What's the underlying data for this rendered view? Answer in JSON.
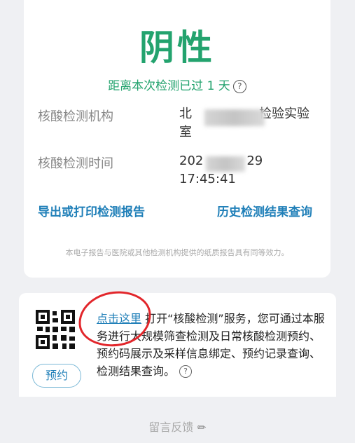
{
  "result": {
    "status": "阴性",
    "since_text": "距离本次检测已过 1 天",
    "help_icon": "?"
  },
  "details": {
    "institution_label": "核酸检测机构",
    "institution_value_start": "北",
    "institution_value_end": "检验实验",
    "institution_value_line2": "室",
    "time_label": "核酸检测时间",
    "time_value_start": "202",
    "time_value_end": "29 17:45:41"
  },
  "links": {
    "export": "导出或打印检测报告",
    "history": "历史检测结果查询"
  },
  "disclaimer": "本电子报告与医院或其他检测机构提供的纸质报告具有同等效力。",
  "booking": {
    "tap_here": "点击这里",
    "description": "打开“核酸检测”服务，您可通过本服务进行大规模筛查检测及日常核酸检测预约、预约码展示及采样信息绑定、预约记录查询、检测结果查询。",
    "book_button": "预约",
    "help_icon": "?"
  },
  "feedback": {
    "label": "留言反馈",
    "icon": "pen-icon"
  },
  "colors": {
    "negative_green": "#23a36e",
    "link_blue": "#1f7fb8",
    "annotation_red": "#e2262b"
  }
}
